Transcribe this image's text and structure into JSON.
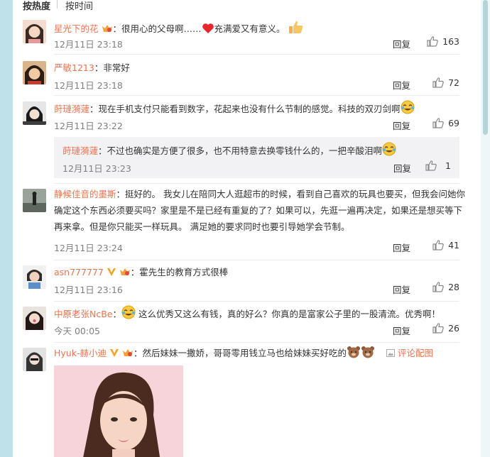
{
  "sort": {
    "hot": "按热度",
    "time": "按时间"
  },
  "comments": [
    {
      "user": "星光下的花",
      "text_a": "：很用心的父母啊……",
      "text_b": "充满爱又有意义。",
      "time": "12月11日 23:18",
      "reply": "回复",
      "likes": "163"
    },
    {
      "user": "严敏1213",
      "text": "：非常好",
      "time": "12月11日 23:18",
      "reply": "回复",
      "likes": "72"
    },
    {
      "user": "莳璉漪蘧",
      "text": "：现在手机支付只能看到数字，花起来也没有什么节制的感觉。科技的双刃剑啊",
      "time": "12月11日 23:22",
      "reply": "回复",
      "likes": "69"
    },
    {
      "user": "静候佳音的墨斯",
      "text": "：挺好的。 我女儿在陪同大人逛超市的时候，看到自己喜欢的玩具也要买，但我会问她你确定这个东西必须要买吗？家里是不是已经有重复的了？如果可以，先逛一遍再决定，如果还是想买等下再来拿。但是你只能买一样玩具。 满足她的要求同时也要引导她学会节制。",
      "time": "12月11日 23:24",
      "reply": "回复",
      "likes": "41"
    },
    {
      "user": "asn777777",
      "text": "：霍先生的教育方式很棒",
      "time": "12月11日 23:16",
      "reply": "回复",
      "likes": "28"
    },
    {
      "user": "中原老张NcBe",
      "text_a": "：",
      "text_b": "这么优秀又这么有钱，真的好么？你真的是富家公子里的一股清流。优秀啊！",
      "time": "今天 00:05",
      "reply": "回复",
      "likes": "26"
    },
    {
      "user": "Hyuk-赫小迪",
      "text": "：然后妹妹一撒娇，哥哥零用钱立马也给妹妹买好吃的",
      "pic_link": "评论配图"
    }
  ],
  "nested_reply": {
    "user": "莳璉漪蘧",
    "text": "：不过也确实是方便了很多，也不用特意去换零钱什么的，一把辛酸泪啊",
    "time": "12月11日 23:23",
    "reply": "回复",
    "likes": "1"
  },
  "colors": {
    "username": "#eb7350",
    "meta": "#808080",
    "page_bg": "#bfe1ea"
  }
}
